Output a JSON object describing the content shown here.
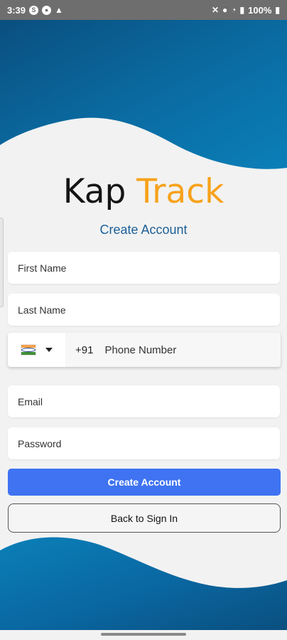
{
  "status_bar": {
    "time": "3:39",
    "battery": "100%",
    "left_icons": [
      "skype-icon",
      "chrome-icon",
      "warning-icon"
    ],
    "right_icons": [
      "mute-icon",
      "location-icon",
      "wifi-icon",
      "signal-icon",
      "battery-icon"
    ]
  },
  "logo": {
    "part1": "Kap",
    "part2": "Track"
  },
  "subtitle": "Create Account",
  "fields": {
    "first_name": {
      "placeholder": "First Name",
      "value": ""
    },
    "last_name": {
      "placeholder": "Last Name",
      "value": ""
    },
    "phone": {
      "country_flag": "india-flag-icon",
      "dial_code": "+91",
      "placeholder": "Phone Number",
      "value": ""
    },
    "email": {
      "placeholder": "Email",
      "value": ""
    },
    "password": {
      "placeholder": "Password",
      "value": ""
    }
  },
  "buttons": {
    "create_account": "Create Account",
    "back_to_sign_in": "Back to Sign In"
  },
  "colors": {
    "wave_dark": "#0a4f7f",
    "wave_light": "#0b76b0",
    "background": "#f2f2f2",
    "primary_button": "#3f73f2",
    "logo_accent": "#f7a21b",
    "subtitle": "#1d5f96"
  }
}
